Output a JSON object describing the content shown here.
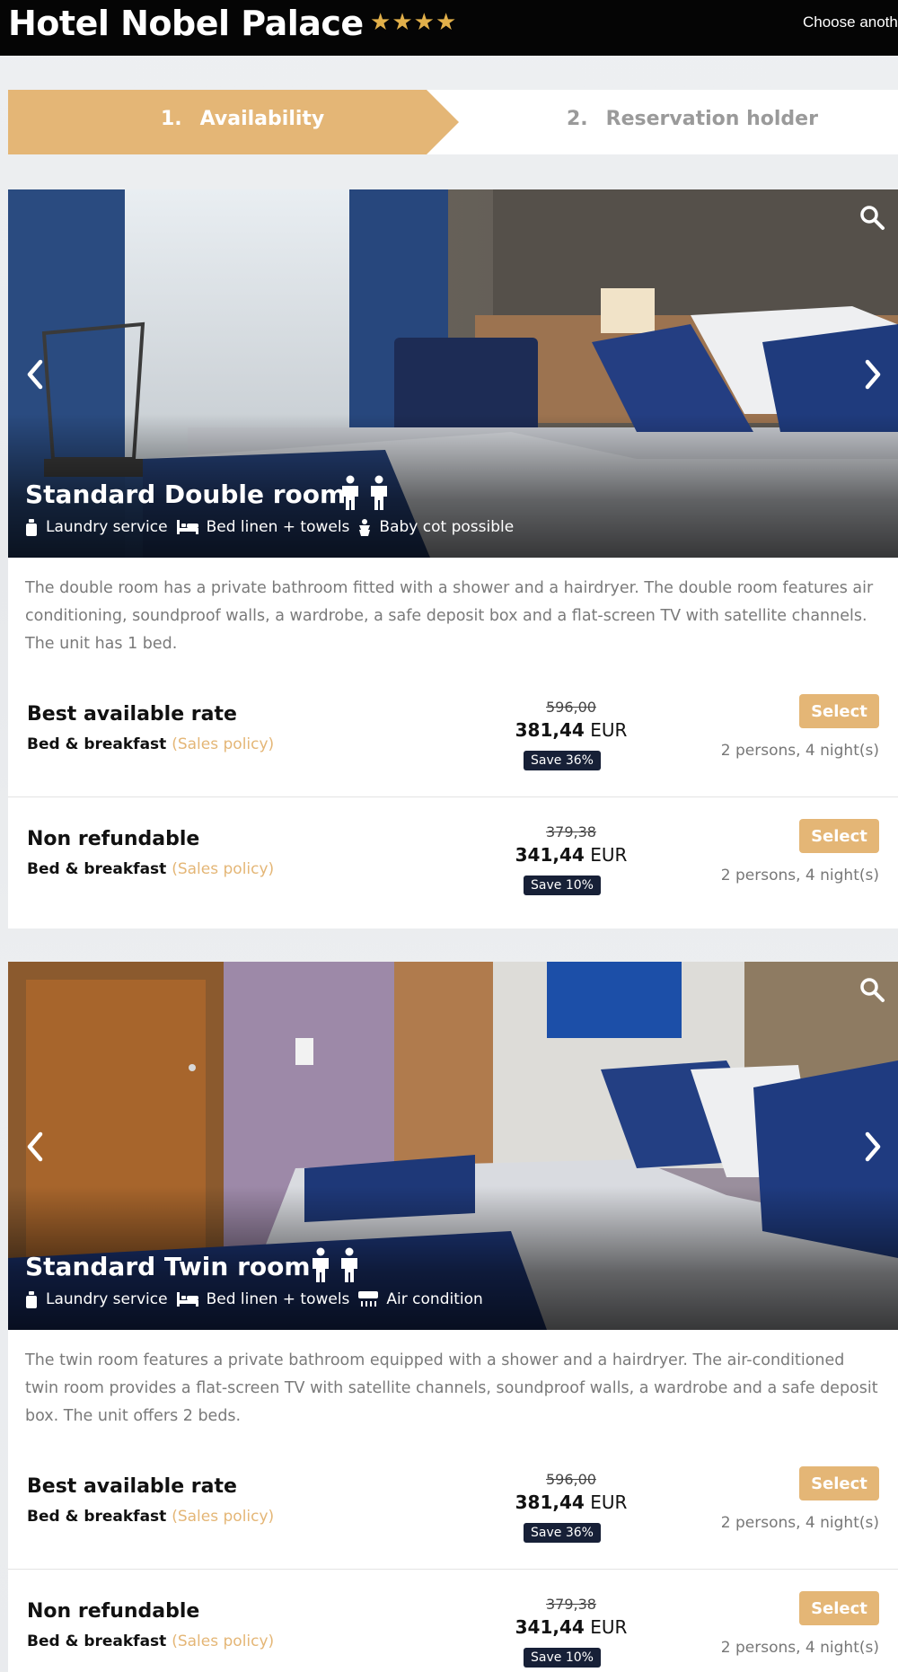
{
  "header": {
    "hotel_name": "Hotel Nobel Palace",
    "stars": 4,
    "choose_other": "Choose anoth"
  },
  "steps": [
    {
      "number": "1.",
      "label": "Availability",
      "active": true
    },
    {
      "number": "2.",
      "label": "Reservation holder",
      "active": false
    }
  ],
  "colors": {
    "accent": "#e4b676",
    "badge": "#172037",
    "topbar": "#050505"
  },
  "rooms": [
    {
      "title": "Standard Double room",
      "persons": 2,
      "amenities": [
        {
          "icon": "laundry-icon",
          "label": "Laundry service"
        },
        {
          "icon": "bed-icon",
          "label": "Bed linen + towels"
        },
        {
          "icon": "baby-cot-icon",
          "label": "Baby cot possible"
        }
      ],
      "description": "The double room has a private bathroom fitted with a shower and a hairdryer. The double room features air conditioning, soundproof walls, a wardrobe, a safe deposit box and a flat-screen TV with satellite channels. The unit has 1 bed.",
      "rates": [
        {
          "name": "Best available rate",
          "board": "Bed & breakfast",
          "policy": "(Sales policy)",
          "old_price": "596,00",
          "price": "381,44",
          "currency": "EUR",
          "save": "Save 36%",
          "select": "Select",
          "occupancy": "2 persons, 4 night(s)"
        },
        {
          "name": "Non refundable",
          "board": "Bed & breakfast",
          "policy": "(Sales policy)",
          "old_price": "379,38",
          "price": "341,44",
          "currency": "EUR",
          "save": "Save 10%",
          "select": "Select",
          "occupancy": "2 persons, 4 night(s)"
        }
      ]
    },
    {
      "title": "Standard Twin room",
      "persons": 2,
      "amenities": [
        {
          "icon": "laundry-icon",
          "label": "Laundry service"
        },
        {
          "icon": "bed-icon",
          "label": "Bed linen + towels"
        },
        {
          "icon": "air-condition-icon",
          "label": "Air condition"
        }
      ],
      "description": "The twin room features a private bathroom equipped with a shower and a hairdryer. The air-conditioned twin room provides a flat-screen TV with satellite channels, soundproof walls, a wardrobe and a safe deposit box. The unit offers 2 beds.",
      "rates": [
        {
          "name": "Best available rate",
          "board": "Bed & breakfast",
          "policy": "(Sales policy)",
          "old_price": "596,00",
          "price": "381,44",
          "currency": "EUR",
          "save": "Save 36%",
          "select": "Select",
          "occupancy": "2 persons, 4 night(s)"
        },
        {
          "name": "Non refundable",
          "board": "Bed & breakfast",
          "policy": "(Sales policy)",
          "old_price": "379,38",
          "price": "341,44",
          "currency": "EUR",
          "save": "Save 10%",
          "select": "Select",
          "occupancy": "2 persons, 4 night(s)"
        }
      ]
    }
  ]
}
